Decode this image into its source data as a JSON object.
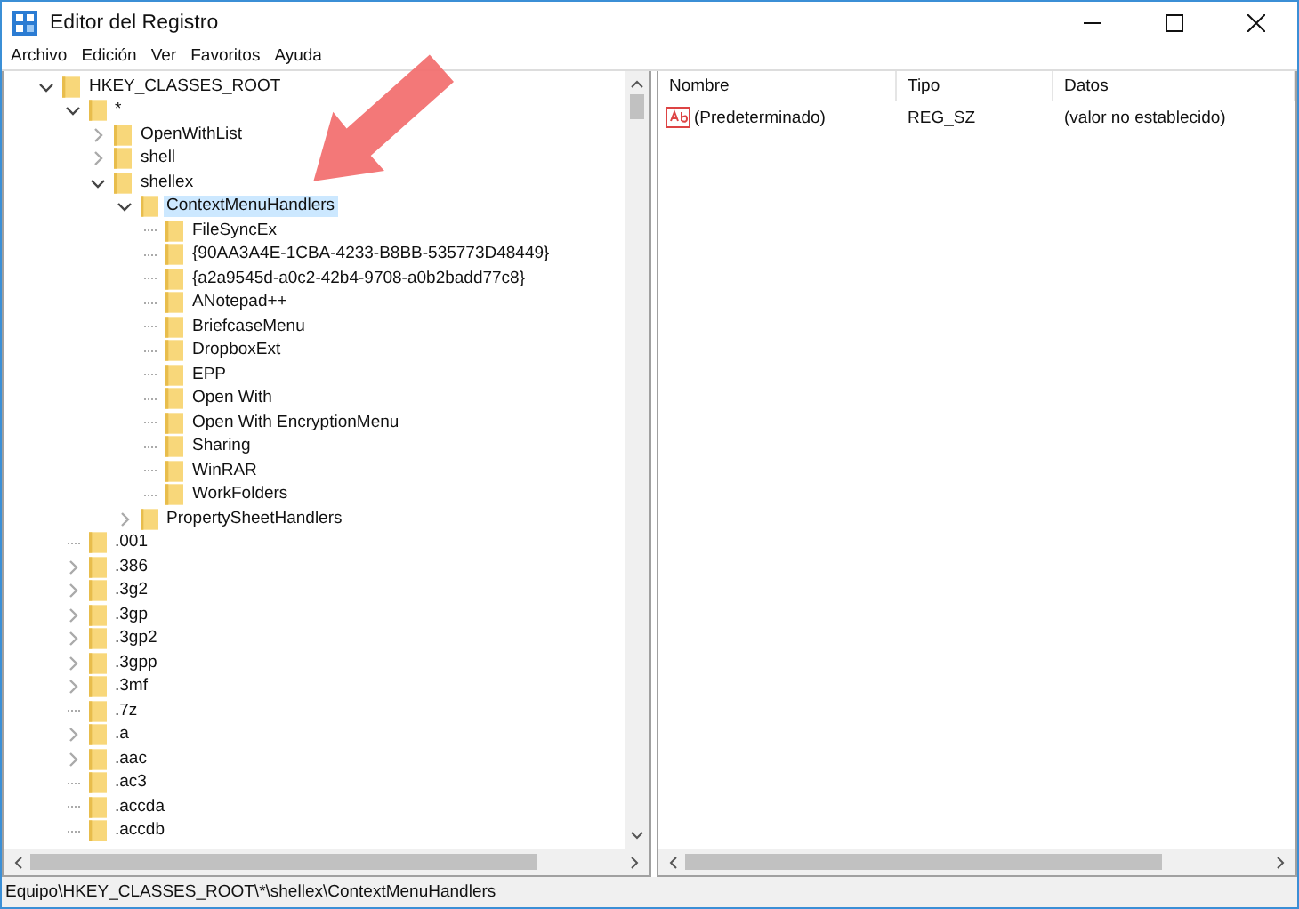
{
  "window": {
    "title": "Editor del Registro"
  },
  "menu": [
    "Archivo",
    "Edición",
    "Ver",
    "Favoritos",
    "Ayuda"
  ],
  "tree": [
    {
      "label": "HKEY_CLASSES_ROOT",
      "expanded": true,
      "selected": false,
      "children": [
        {
          "label": "*",
          "expanded": true,
          "selected": false,
          "children": [
            {
              "label": "OpenWithList",
              "expanded": false,
              "selected": false
            },
            {
              "label": "shell",
              "expanded": false,
              "selected": false
            },
            {
              "label": "shellex",
              "expanded": true,
              "selected": false,
              "children": [
                {
                  "label": "ContextMenuHandlers",
                  "expanded": true,
                  "selected": true,
                  "children": [
                    {
                      "label": "FileSyncEx",
                      "selected": false
                    },
                    {
                      "label": "{90AA3A4E-1CBA-4233-B8BB-535773D48449}",
                      "selected": false
                    },
                    {
                      "label": "{a2a9545d-a0c2-42b4-9708-a0b2badd77c8}",
                      "selected": false
                    },
                    {
                      "label": "ANotepad++",
                      "selected": false
                    },
                    {
                      "label": "BriefcaseMenu",
                      "selected": false
                    },
                    {
                      "label": "DropboxExt",
                      "selected": false
                    },
                    {
                      "label": "EPP",
                      "selected": false
                    },
                    {
                      "label": "Open With",
                      "selected": false
                    },
                    {
                      "label": "Open With EncryptionMenu",
                      "selected": false
                    },
                    {
                      "label": "Sharing",
                      "selected": false
                    },
                    {
                      "label": "WinRAR",
                      "selected": false
                    },
                    {
                      "label": "WorkFolders",
                      "selected": false
                    }
                  ]
                },
                {
                  "label": "PropertySheetHandlers",
                  "expanded": false,
                  "selected": false
                }
              ]
            }
          ]
        },
        {
          "label": ".001",
          "selected": false
        },
        {
          "label": ".386",
          "expanded": false,
          "selected": false
        },
        {
          "label": ".3g2",
          "expanded": false,
          "selected": false
        },
        {
          "label": ".3gp",
          "expanded": false,
          "selected": false
        },
        {
          "label": ".3gp2",
          "expanded": false,
          "selected": false
        },
        {
          "label": ".3gpp",
          "expanded": false,
          "selected": false
        },
        {
          "label": ".3mf",
          "expanded": false,
          "selected": false
        },
        {
          "label": ".7z",
          "selected": false
        },
        {
          "label": ".a",
          "expanded": false,
          "selected": false
        },
        {
          "label": ".aac",
          "expanded": false,
          "selected": false
        },
        {
          "label": ".ac3",
          "selected": false
        },
        {
          "label": ".accda",
          "selected": false
        },
        {
          "label": ".accdb",
          "selected": false
        }
      ]
    }
  ],
  "values": {
    "columns": [
      "Nombre",
      "Tipo",
      "Datos"
    ],
    "rows": [
      {
        "name": "(Predeterminado)",
        "type": "REG_SZ",
        "data": "(valor no establecido)"
      }
    ]
  },
  "status_bar": "Equipo\\HKEY_CLASSES_ROOT\\*\\shellex\\ContextMenuHandlers"
}
